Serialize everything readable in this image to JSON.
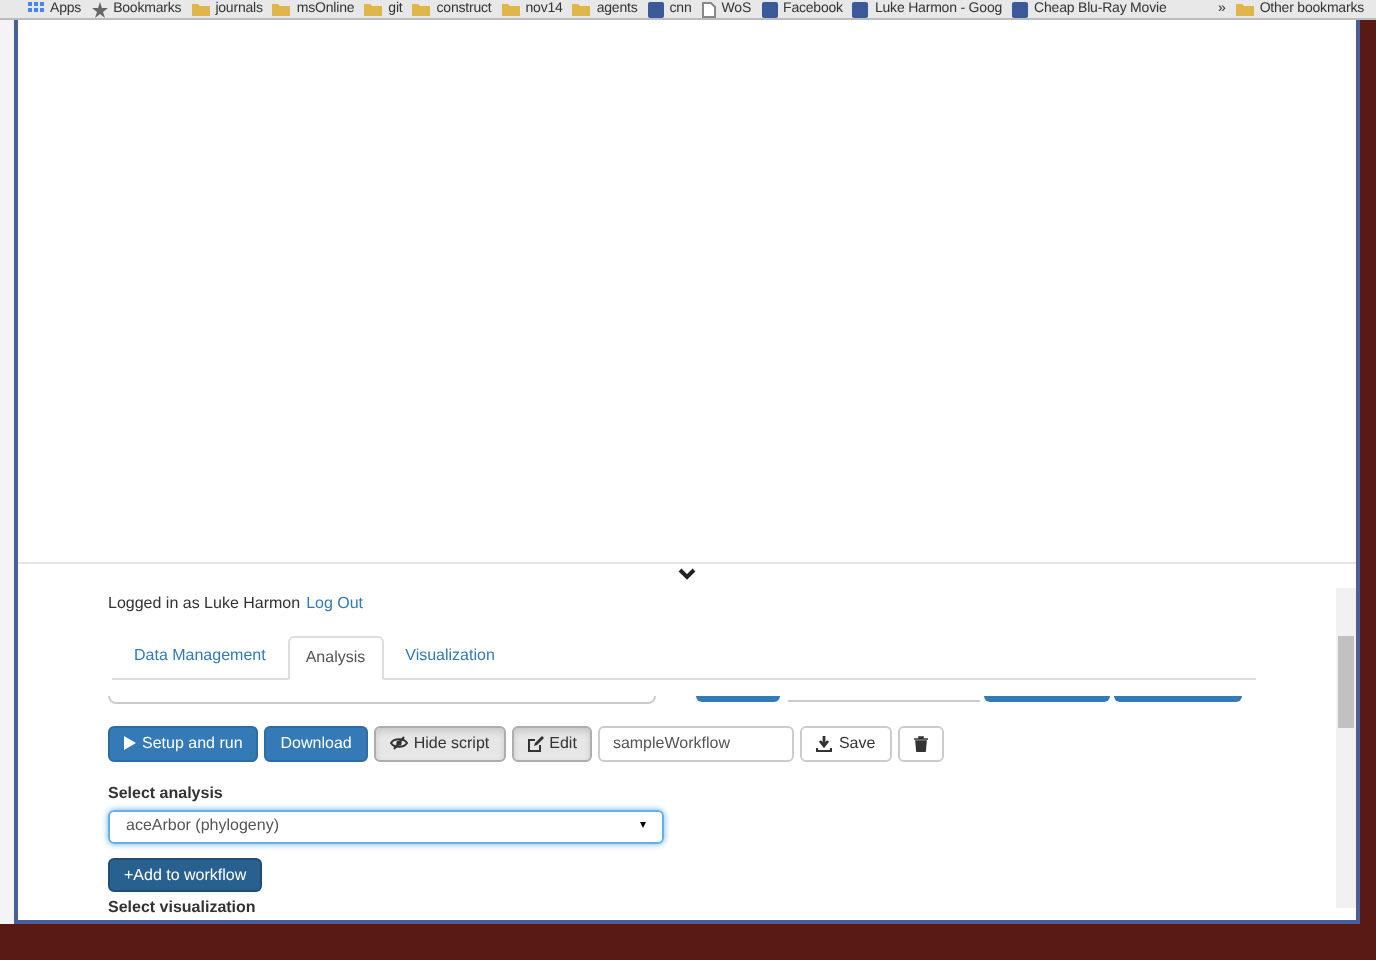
{
  "bookmarks": [
    {
      "label": "Apps",
      "kind": "apps"
    },
    {
      "label": "Bookmarks",
      "kind": "star"
    },
    {
      "label": "journals",
      "kind": "folder"
    },
    {
      "label": "msOnline",
      "kind": "folder"
    },
    {
      "label": "git",
      "kind": "folder"
    },
    {
      "label": "construct",
      "kind": "folder"
    },
    {
      "label": "nov14",
      "kind": "folder"
    },
    {
      "label": "agents",
      "kind": "folder"
    },
    {
      "label": "cnn",
      "kind": "site"
    },
    {
      "label": "WoS",
      "kind": "page"
    },
    {
      "label": "Facebook",
      "kind": "site"
    },
    {
      "label": "Luke Harmon - Goog",
      "kind": "site"
    },
    {
      "label": "Cheap Blu-Ray Movie",
      "kind": "site"
    }
  ],
  "bookmarks_overflow": "»",
  "other_bookmarks": "Other bookmarks",
  "login": {
    "text": "Logged in as Luke Harmon",
    "link": "Log Out"
  },
  "tabs": [
    {
      "label": "Data Management",
      "selected": false
    },
    {
      "label": "Analysis",
      "selected": true
    },
    {
      "label": "Visualization",
      "selected": false
    }
  ],
  "toolbar": [
    {
      "kind": "run",
      "label": "Setup and run"
    },
    {
      "kind": "download",
      "label": "Download"
    },
    {
      "kind": "toggle",
      "label": "Hide script"
    },
    {
      "kind": "edit",
      "label": "Edit"
    },
    {
      "kind": "field",
      "value": "sampleWorkflow"
    },
    {
      "kind": "save",
      "label": "Save"
    },
    {
      "kind": "delete"
    }
  ],
  "analysis": {
    "label": "Select analysis",
    "value": "aceArbor (phylogeny)",
    "caret": "▾",
    "add_button": "+Add to workflow"
  },
  "next_label": "Select visualization"
}
